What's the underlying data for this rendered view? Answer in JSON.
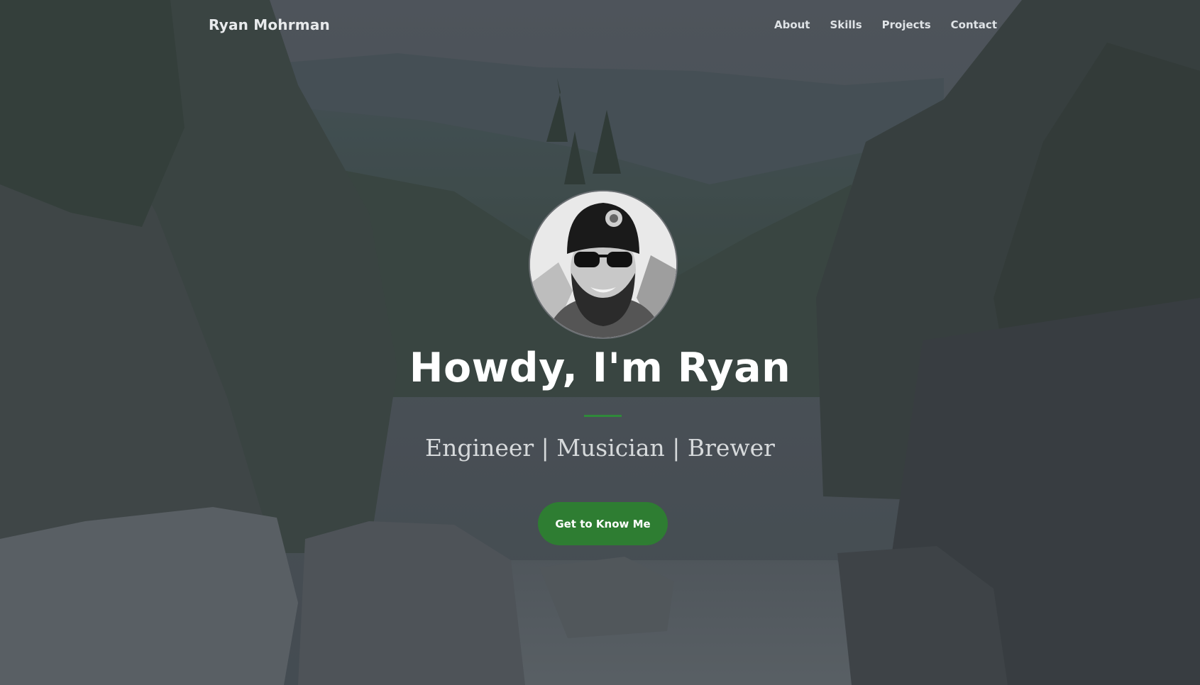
{
  "navbar": {
    "brand": "Ryan Mohrman",
    "links": [
      {
        "label": "About"
      },
      {
        "label": "Skills"
      },
      {
        "label": "Projects"
      },
      {
        "label": "Contact"
      }
    ]
  },
  "hero": {
    "headline": "Howdy, I'm Ryan",
    "subtitle": "Engineer | Musician | Brewer",
    "cta_label": "Get to Know Me",
    "avatar_alt": "profile photo",
    "colors": {
      "accent": "#2e7d32",
      "divider": "#2f8a3a",
      "overlay": "#343a40"
    }
  }
}
